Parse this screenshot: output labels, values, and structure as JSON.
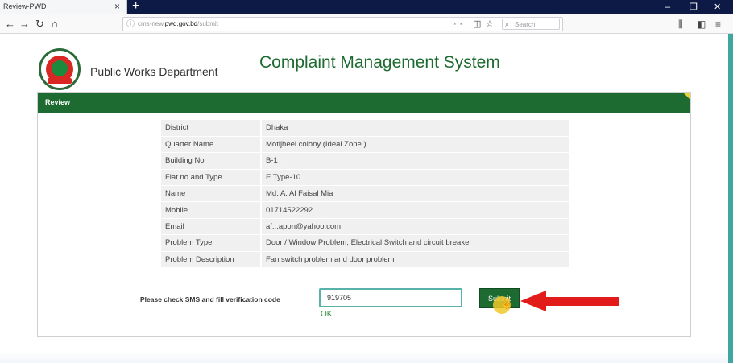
{
  "browser": {
    "tab_title": "Review-PWD",
    "tab_close": "×",
    "new_tab": "+",
    "url_scheme": "cms-new.",
    "url_domain": "pwd.gov.bd",
    "url_path": "/submit",
    "page_actions": "···",
    "search_placeholder": "Search",
    "window_minimize": "–",
    "window_restore": "❐",
    "window_close": "✕"
  },
  "header": {
    "department": "Public Works Department",
    "system_title": "Complaint Management System"
  },
  "panel": {
    "title": "Review"
  },
  "review_rows": [
    {
      "label": "District",
      "value": "Dhaka"
    },
    {
      "label": "Quarter Name",
      "value": "Motijheel colony (Ideal Zone )"
    },
    {
      "label": "Building No",
      "value": "B-1"
    },
    {
      "label": "Flat no and Type",
      "value": "E Type-10"
    },
    {
      "label": "Name",
      "value": "Md. A. Al Faisal Mia"
    },
    {
      "label": "Mobile",
      "value": "01714522292"
    },
    {
      "label": "Email",
      "value": "af...apon@yahoo.com"
    },
    {
      "label": "Problem Type",
      "value": "Door / Window Problem, Electrical Switch and circuit breaker"
    },
    {
      "label": "Problem Description",
      "value": "Fan switch problem and door problem"
    }
  ],
  "verification": {
    "label": "Please check SMS and fill verification code",
    "code_value": "919705",
    "status": "OK",
    "submit_label": "Submit"
  },
  "colors": {
    "brand_green": "#1d6b31",
    "annotation_arrow": "#e21b1b"
  }
}
